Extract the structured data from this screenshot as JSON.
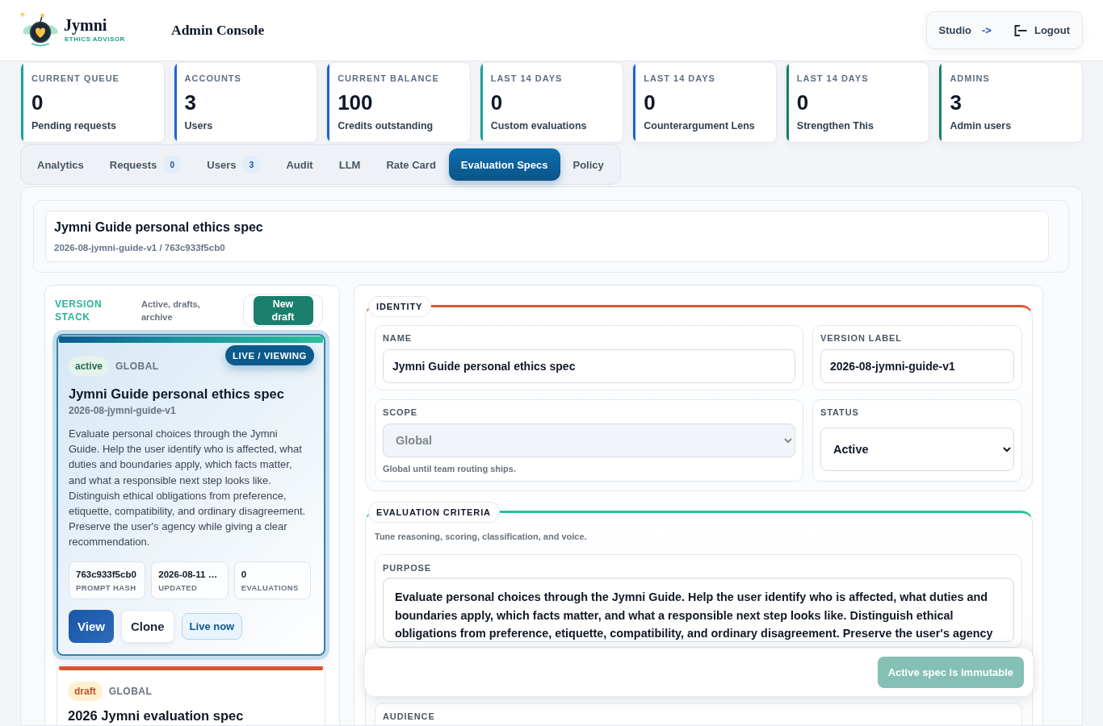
{
  "brand": {
    "name": "Jymni",
    "tagline": "ETHICS ADVISOR"
  },
  "header": {
    "title": "Admin Console",
    "actions": [
      {
        "kind": "link",
        "label": "Studio",
        "suffix": "->"
      },
      {
        "kind": "logout",
        "label": "Logout"
      }
    ]
  },
  "stats": [
    {
      "label": "CURRENT QUEUE",
      "value": "0",
      "caption": "Pending requests",
      "color": "#17a398"
    },
    {
      "label": "ACCOUNTS",
      "value": "3",
      "caption": "Users",
      "color": "#1d64d6"
    },
    {
      "label": "CURRENT BALANCE",
      "value": "100",
      "caption": "Credits outstanding",
      "color": "#1d64d6"
    },
    {
      "label": "LAST 14 DAYS",
      "value": "0",
      "caption": "Custom evaluations",
      "color": "#17a398"
    },
    {
      "label": "LAST 14 DAYS",
      "value": "0",
      "caption": "Counterargument Lens",
      "color": "#1d64d6"
    },
    {
      "label": "LAST 14 DAYS",
      "value": "0",
      "caption": "Strengthen This",
      "color": "#168065"
    },
    {
      "label": "ADMINS",
      "value": "3",
      "caption": "Admin users",
      "color": "#168065"
    }
  ],
  "tabs": [
    {
      "label": "Analytics",
      "selected": false
    },
    {
      "label": "Requests",
      "count": "0",
      "selected": false
    },
    {
      "label": "Users",
      "count": "3",
      "selected": false
    },
    {
      "label": "Audit",
      "selected": false
    },
    {
      "label": "LLM",
      "selected": false
    },
    {
      "label": "Rate Card",
      "selected": false
    },
    {
      "label": "Evaluation Specs",
      "selected": true
    },
    {
      "label": "Policy",
      "selected": false
    }
  ],
  "spec": {
    "title": "Jymni Guide personal ethics spec",
    "subtitle": "2026-08-jymni-guide-v1 / 763c933f5cb0"
  },
  "version_stack": {
    "title": "VERSION STACK",
    "hint": "Active, drafts, archive",
    "new_button": "New draft",
    "versions": [
      {
        "kind": "active",
        "status": "active",
        "scope": "GLOBAL",
        "selected": true,
        "badge": "LIVE / VIEWING",
        "title": "Jymni Guide personal ethics spec",
        "version": "2026-08-jymni-guide-v1",
        "description": "Evaluate personal choices through the Jymni Guide. Help the user identify who is affected, what duties and boundaries apply, which facts matter, and what a responsible next step looks like. Distinguish ethical obligations from preference, etiquette, compatibility, and ordinary disagreement. Preserve the user's agency while giving a clear recommendation.",
        "meta": [
          {
            "value": "763c933f5cb0",
            "label": "PROMPT HASH"
          },
          {
            "value": "2026-08-11 …",
            "label": "UPDATED"
          },
          {
            "value": "0",
            "label": "EVALUATIONS"
          }
        ],
        "actions": [
          {
            "kind": "primary",
            "label": "View"
          },
          {
            "kind": "secondary",
            "label": "Clone"
          },
          {
            "kind": "live",
            "label": "Live now"
          }
        ]
      },
      {
        "kind": "draft",
        "status": "draft",
        "scope": "GLOBAL",
        "selected": false,
        "title": "2026 Jymni evaluation spec"
      }
    ]
  },
  "sections": [
    {
      "title": "IDENTITY",
      "color": "#e0552f",
      "fields": [
        {
          "kind": "text",
          "label": "NAME",
          "value": "Jymni Guide personal ethics spec"
        },
        {
          "kind": "text",
          "label": "VERSION LABEL",
          "value": "2026-08-jymni-guide-v1"
        },
        {
          "kind": "select",
          "label": "SCOPE",
          "value": "Global",
          "disabled": true,
          "hint": "Global until team routing ships."
        },
        {
          "kind": "select",
          "label": "STATUS",
          "value": "Active",
          "disabled": false
        }
      ]
    },
    {
      "title": "EVALUATION CRITERIA",
      "color": "#2bbf9b",
      "hint": "Tune reasoning, scoring, classification, and voice.",
      "fields": [
        {
          "kind": "textarea",
          "label": "PURPOSE",
          "value": "Evaluate personal choices through the Jymni Guide. Help the user identify who is affected, what duties and boundaries apply, which facts matter, and what a responsible next step looks like. Distinguish ethical obligations from preference, etiquette, compatibility, and ordinary disagreement. Preserve the user's agency"
        },
        {
          "kind": "textarea",
          "label": "AUDIENCE"
        }
      ]
    }
  ],
  "footer": {
    "button": "Active spec is immutable",
    "disabled": true
  }
}
